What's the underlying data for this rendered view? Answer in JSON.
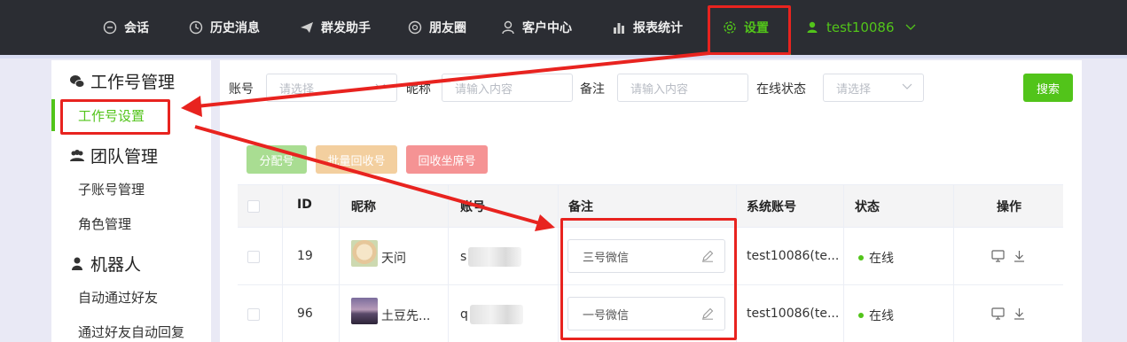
{
  "nav": {
    "items": [
      {
        "label": "会话",
        "icon": "chat-icon"
      },
      {
        "label": "历史消息",
        "icon": "clock-icon"
      },
      {
        "label": "群发助手",
        "icon": "send-icon"
      },
      {
        "label": "朋友圈",
        "icon": "aperture-icon"
      },
      {
        "label": "客户中心",
        "icon": "user-outline-icon"
      },
      {
        "label": "报表统计",
        "icon": "bar-chart-icon"
      },
      {
        "label": "设置",
        "icon": "gear-icon"
      }
    ],
    "user": "test10086"
  },
  "sidebar": {
    "groups": [
      {
        "title": "工作号管理",
        "icon": "wechat-icon",
        "items": [
          "工作号设置"
        ]
      },
      {
        "title": "团队管理",
        "icon": "team-icon",
        "items": [
          "子账号管理",
          "角色管理"
        ]
      },
      {
        "title": "机器人",
        "icon": "robot-icon",
        "items": [
          "自动通过好友",
          "通过好友自动回复"
        ]
      }
    ],
    "active_item": "工作号设置"
  },
  "filters": {
    "account_label": "账号",
    "account_placeholder": "请选择",
    "nickname_label": "昵称",
    "nickname_placeholder": "请输入内容",
    "remark_label": "备注",
    "remark_placeholder": "请输入内容",
    "status_label": "在线状态",
    "status_placeholder": "请选择",
    "search_button": "搜索"
  },
  "actions": {
    "assign": "分配号",
    "batch_recycle": "批量回收号",
    "recycle_seat": "回收坐席号"
  },
  "table": {
    "headers": [
      "ID",
      "昵称",
      "账号",
      "备注",
      "系统账号",
      "状态",
      "操作"
    ],
    "rows": [
      {
        "id": "19",
        "nickname": "天问",
        "account": "s",
        "remark": "三号微信",
        "system_account": "test10086(te...",
        "status": "在线"
      },
      {
        "id": "96",
        "nickname": "土豆先...",
        "account": "q",
        "remark": "一号微信",
        "system_account": "test10086(te...",
        "status": "在线"
      }
    ]
  },
  "colors": {
    "accent": "#52c41a",
    "topbar": "#2b2d33",
    "annotation_red": "#e8231f",
    "assign_btn": "#a9dd92",
    "batch_btn": "#f3cf9f",
    "recycle_btn": "#f59394"
  }
}
